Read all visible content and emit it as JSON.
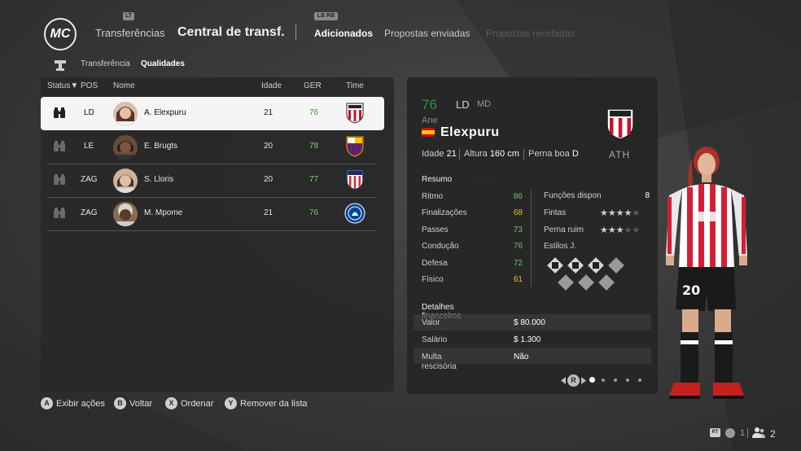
{
  "header": {
    "logo_text": "MC",
    "left_badge": "LT",
    "right_badge": "LB RB",
    "nav_transfers": "Transferências",
    "nav_title": "Central de transf.",
    "tabs": [
      {
        "label": "Adicionados",
        "state": "active"
      },
      {
        "label": "Propostas enviadas",
        "state": "inactive"
      },
      {
        "label": "Propostas recebidas",
        "state": "disabled"
      }
    ]
  },
  "subtabs": [
    {
      "label": "Transferência",
      "active": false
    },
    {
      "label": "Qualidades",
      "active": true
    }
  ],
  "list": {
    "columns": [
      "Status",
      "POS",
      "Nome",
      "Idade",
      "GER",
      "Time"
    ],
    "sort_indicator": "▼",
    "rows": [
      {
        "pos": "LD",
        "name": "A. Elexpuru",
        "age": "21",
        "ger": "76",
        "team": "Athletic Club",
        "selected": true
      },
      {
        "pos": "LE",
        "name": "E. Brugts",
        "age": "20",
        "ger": "78",
        "team": "FC Barcelona",
        "selected": false
      },
      {
        "pos": "ZAG",
        "name": "S. Lloris",
        "age": "20",
        "ger": "77",
        "team": "Atlético de Madrid",
        "selected": false
      },
      {
        "pos": "ZAG",
        "name": "M. Mpome",
        "age": "21",
        "ger": "76",
        "team": "Chelsea",
        "selected": false
      }
    ]
  },
  "detail": {
    "overall": "76",
    "position": "LD",
    "alt_position": "MD",
    "first_name": "Ane",
    "last_name": "Elexpuru",
    "nationality_flag": "spain",
    "age_label": "Idade",
    "age": "21",
    "height_label": "Altura",
    "height": "160 cm",
    "foot_label": "Perna boa",
    "foot": "D",
    "club_abbr": "ATH",
    "summary_title": "Resumo",
    "stats": [
      {
        "label": "Ritmo",
        "value": "86",
        "color": "#6cc36a"
      },
      {
        "label": "Finalizações",
        "value": "68",
        "color": "#e0c02a"
      },
      {
        "label": "Passes",
        "value": "73",
        "color": "#6cc36a"
      },
      {
        "label": "Condução",
        "value": "76",
        "color": "#6cc36a"
      },
      {
        "label": "Defesa",
        "value": "72",
        "color": "#6cc36a"
      },
      {
        "label": "Físico",
        "value": "61",
        "color": "#e0c02a"
      }
    ],
    "functions_label": "Funções disponíveis",
    "functions_value": "8",
    "skill_moves_label": "Fintas",
    "skill_moves_stars": 4,
    "weak_foot_label": "Perna ruim",
    "weak_foot_stars": 3,
    "playstyles_label": "Estilos J.",
    "financial_title": "Detalhes financeiros",
    "financial": [
      {
        "label": "Valor",
        "value": "$ 80.000"
      },
      {
        "label": "Salário",
        "value": "$ 1.300"
      },
      {
        "label": "Multa rescisória",
        "value": "Não"
      }
    ],
    "pager_button": "R",
    "page_count": 5,
    "current_page": 1
  },
  "footer": {
    "actions": [
      {
        "button": "A",
        "label": "Exibir ações"
      },
      {
        "button": "B",
        "label": "Voltar"
      },
      {
        "button": "X",
        "label": "Ordenar"
      },
      {
        "button": "Y",
        "label": "Remover da lista"
      }
    ],
    "rt_label": "RT",
    "left_count": "1",
    "right_count": "2"
  },
  "colors": {
    "good": "#6cc36a",
    "avg": "#e0c02a",
    "overall": "#2f8f45"
  }
}
